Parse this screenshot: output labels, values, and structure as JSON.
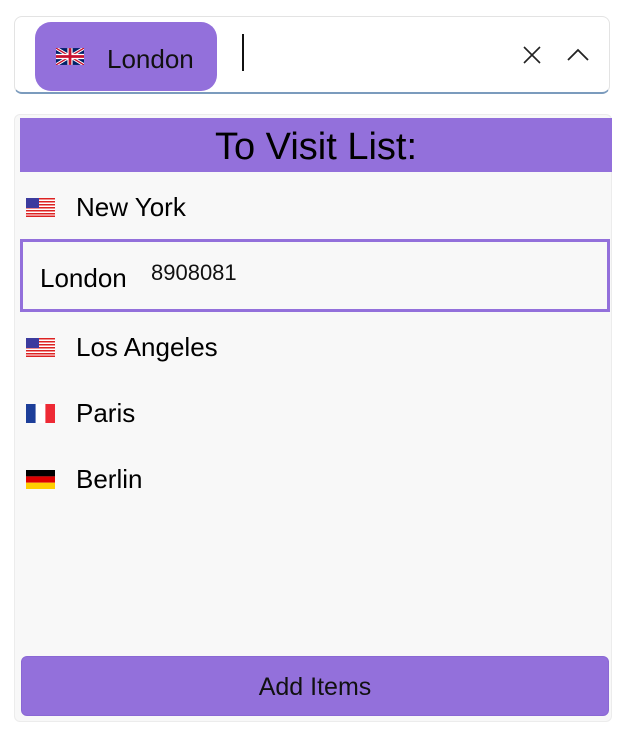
{
  "combo": {
    "selected_chip": {
      "label": "London",
      "flag_icon": "uk-flag-icon"
    },
    "input_value": "",
    "clear_icon": "close-icon",
    "toggle_icon": "chevron-up-icon"
  },
  "dropdown": {
    "header": "To Visit List:",
    "items": [
      {
        "label": "New York",
        "flag_icon": "us-flag-icon"
      },
      {
        "label": "London",
        "code": "8908081",
        "selected": true
      },
      {
        "label": "Los Angeles",
        "flag_icon": "us-flag-icon"
      },
      {
        "label": "Paris",
        "flag_icon": "france-flag-icon"
      },
      {
        "label": "Berlin",
        "flag_icon": "germany-flag-icon"
      }
    ],
    "add_button_label": "Add Items"
  },
  "colors": {
    "accent": "#9370db",
    "panel_background": "#f8f8f8",
    "input_underline": "#7b9bbd"
  }
}
